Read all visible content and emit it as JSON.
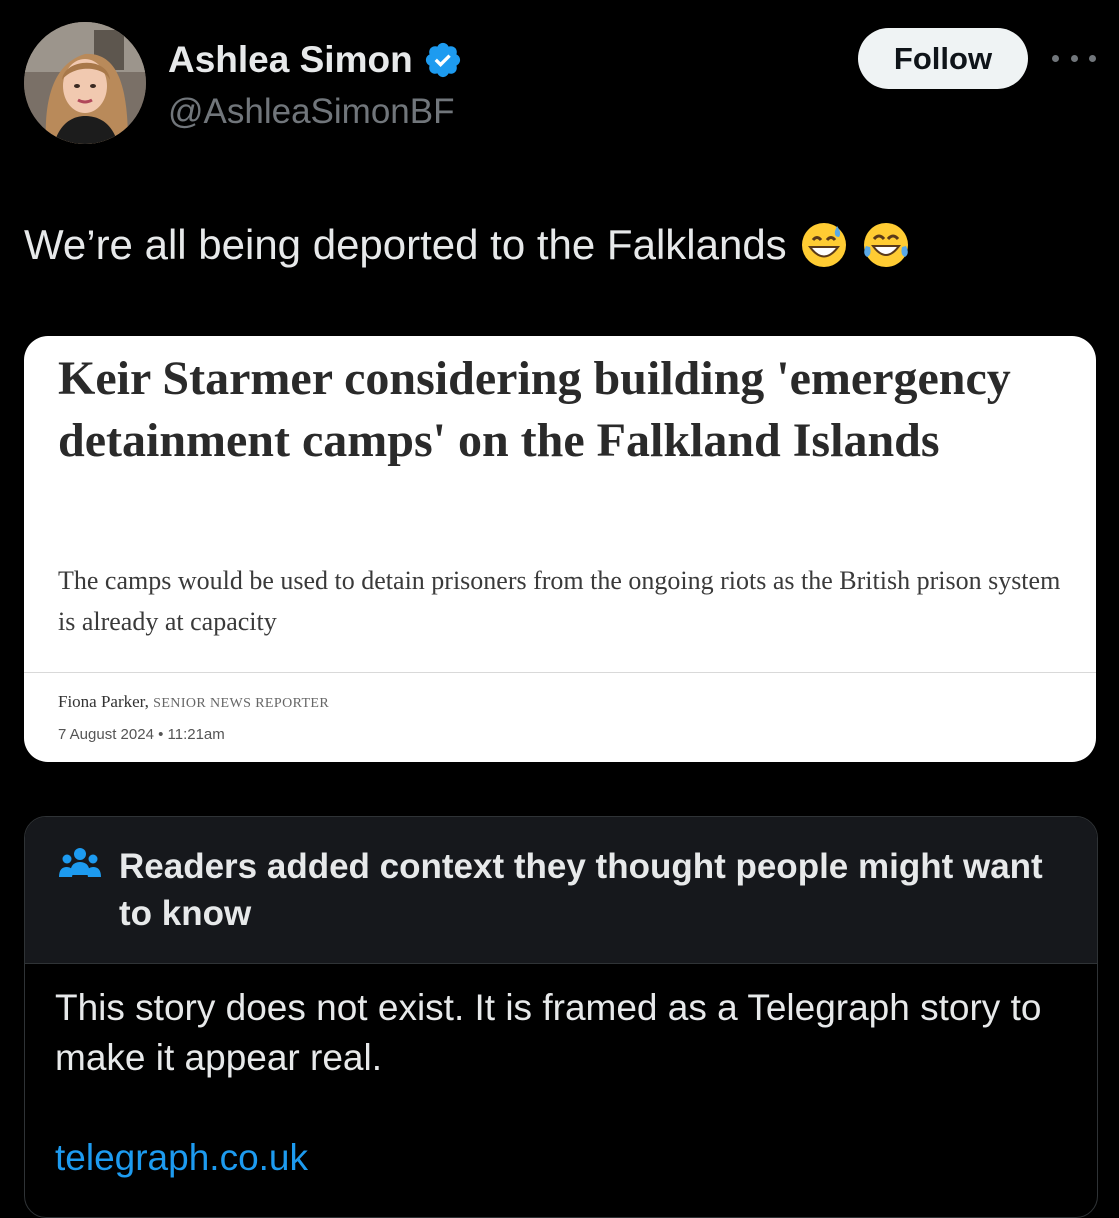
{
  "author": {
    "display_name": "Ashlea Simon",
    "handle": "@AshleaSimonBF",
    "verified_color": "#1d9bf0",
    "avatar_icon": "profile-photo"
  },
  "actions": {
    "follow_label": "Follow",
    "more_icon": "more-horizontal-icon"
  },
  "tweet": {
    "text": "We’re all being deported to the Falklands",
    "emojis": [
      "grinning-sweat-emoji",
      "tears-of-joy-emoji"
    ]
  },
  "media": {
    "headline": "Keir Starmer considering building 'emergency detainment camps' on the Falkland Islands",
    "subheadline": "The camps would be used to detain prisoners from the ongoing riots as the British prison system is already at capacity",
    "byline_name": "Fiona Parker,",
    "byline_role": "SENIOR NEWS REPORTER",
    "date": "7 August 2024 • 11:21am"
  },
  "community_note": {
    "title": "Readers added context they thought people might want to know",
    "body": "This story does not exist. It is framed as a Telegraph story to make it appear real.",
    "link": "telegraph.co.uk",
    "icon": "people-icon",
    "link_color": "#1d9bf0"
  }
}
